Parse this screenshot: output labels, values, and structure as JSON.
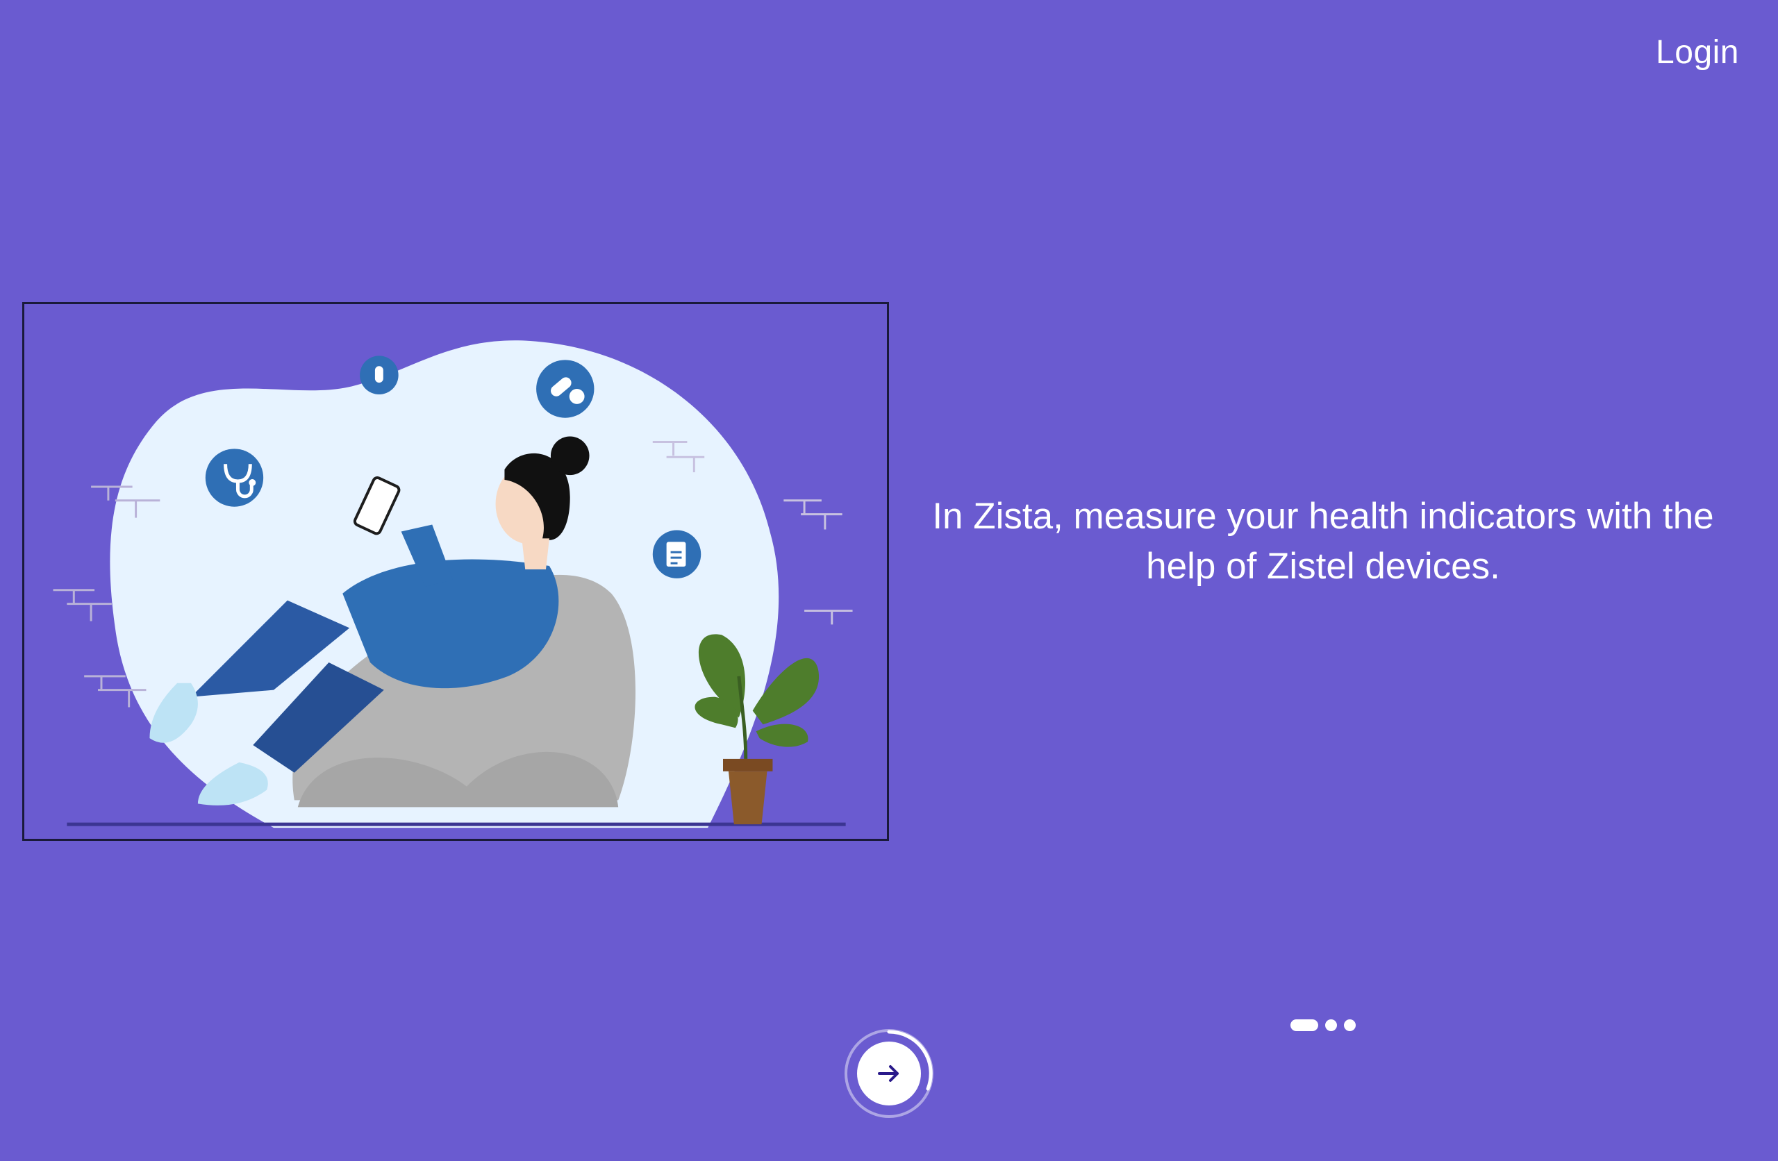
{
  "header": {
    "login_label": "Login"
  },
  "onboarding": {
    "tagline": "In Zista, measure your health indicators with the help of Zistel devices.",
    "pages_total": 3,
    "current_page": 1
  },
  "colors": {
    "background": "#6a5bd0",
    "accent_icon": "#2f6fb5",
    "arrow": "#2a1a8a"
  },
  "icons": {
    "next": "arrow-right-icon"
  }
}
